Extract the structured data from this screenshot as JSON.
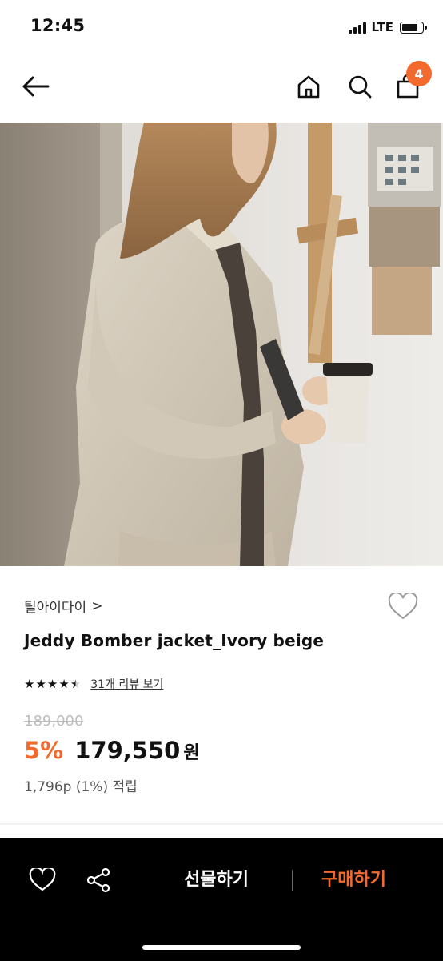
{
  "status_bar": {
    "time": "12:45",
    "network": "LTE",
    "icons": [
      "signal-icon",
      "battery-icon"
    ]
  },
  "nav": {
    "icons": [
      "back-arrow-icon",
      "home-icon",
      "search-icon",
      "cart-icon"
    ],
    "cart_count": "4"
  },
  "product": {
    "brand": "틸아이다이",
    "brand_chevron": ">",
    "name": "Jeddy Bomber jacket_Ivory beige",
    "rating": 4.5,
    "rating_max": 5,
    "review_link": "31개 리뷰 보기",
    "original_price": "189,000",
    "discount": "5%",
    "sale_price": "179,550",
    "currency": "원",
    "points": "1,796p (1%) 적립"
  },
  "bottom_bar": {
    "icons": [
      "heart-icon",
      "share-icon"
    ],
    "gift_label": "선물하기",
    "buy_label": "구매하기"
  },
  "colors": {
    "accent": "#f26a2e",
    "bottom_bar_bg": "#000000",
    "original_price": "#bdbdbd"
  }
}
